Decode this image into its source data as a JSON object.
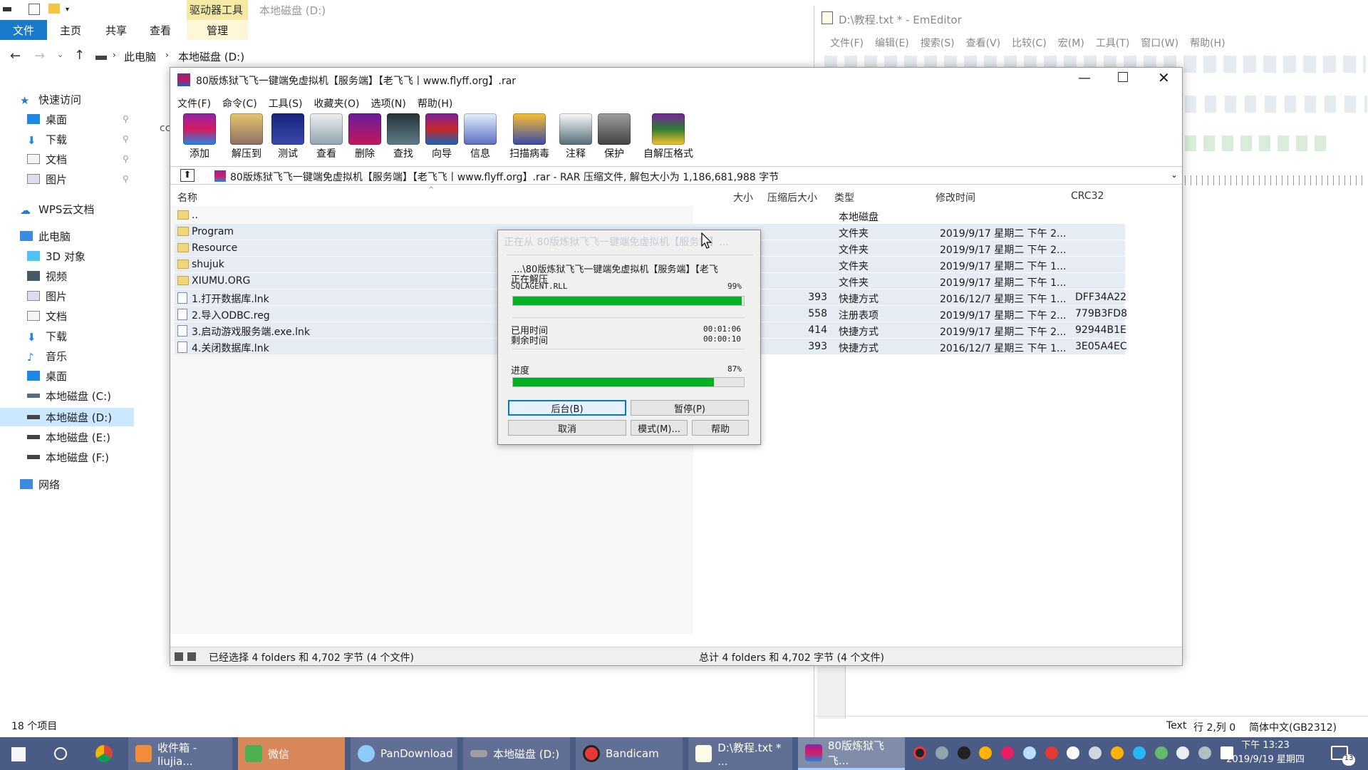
{
  "explorer": {
    "ribbon_context_tab": "驱动器工具",
    "title": "本地磁盘 (D:)",
    "tabs": [
      "文件",
      "主页",
      "共享",
      "查看",
      "管理"
    ],
    "breadcrumb": [
      "此电脑",
      "本地磁盘 (D:)"
    ],
    "nav": [
      "快速访问",
      "桌面",
      "下载",
      "文档",
      "图片",
      "WPS云文档",
      "此电脑",
      "3D 对象",
      "视频",
      "图片",
      "文档",
      "下载",
      "音乐",
      "桌面",
      "本地磁盘 (C:)",
      "本地磁盘 (D:)",
      "本地磁盘 (E:)",
      "本地磁盘 (F:)",
      "网络"
    ],
    "item_count": "18 个项目",
    "partial_text": "cc"
  },
  "emeditor": {
    "title": "D:\\教程.txt * - EmEditor",
    "menu": [
      "文件(F)",
      "编辑(E)",
      "搜索(S)",
      "查看(V)",
      "比较(C)",
      "宏(M)",
      "工具(T)",
      "窗口(W)",
      "帮助(H)"
    ],
    "status": [
      "Text",
      "行 2,列 0",
      "简体中文(GB2312)"
    ]
  },
  "winrar": {
    "title": "80版炼狱飞飞一键端免虚拟机【服务端】【老飞飞丨www.flyff.org】.rar",
    "menu": [
      "文件(F)",
      "命令(C)",
      "工具(S)",
      "收藏夹(O)",
      "选项(N)",
      "帮助(H)"
    ],
    "toolbar": [
      "添加",
      "解压到",
      "测试",
      "查看",
      "删除",
      "查找",
      "向导",
      "信息",
      "扫描病毒",
      "注释",
      "保护",
      "自解压格式"
    ],
    "path": "80版炼狱飞飞一键端免虚拟机【服务端】【老飞飞丨www.flyff.org】.rar - RAR 压缩文件, 解包大小为 1,186,681,988 字节",
    "columns": [
      "名称",
      "大小",
      "压缩后大小",
      "类型",
      "修改时间",
      "CRC32"
    ],
    "files": [
      {
        "name": "..",
        "size": "",
        "packed": "",
        "type": "本地磁盘",
        "modified": "",
        "crc": "",
        "kind": "up"
      },
      {
        "name": "Program",
        "size": "",
        "packed": "",
        "type": "文件夹",
        "modified": "2019/9/17 星期二 下午 2...",
        "crc": "",
        "kind": "folder"
      },
      {
        "name": "Resource",
        "size": "",
        "packed": "",
        "type": "文件夹",
        "modified": "2019/9/17 星期二 下午 2...",
        "crc": "",
        "kind": "folder"
      },
      {
        "name": "shujuk",
        "size": "",
        "packed": "",
        "type": "文件夹",
        "modified": "2019/9/17 星期二 下午 1...",
        "crc": "",
        "kind": "folder"
      },
      {
        "name": "XIUMU.ORG",
        "size": "",
        "packed": "",
        "type": "文件夹",
        "modified": "2019/9/17 星期二 下午 1...",
        "crc": "",
        "kind": "folder"
      },
      {
        "name": "1.打开数据库.lnk",
        "size": "",
        "packed": "393",
        "type": "快捷方式",
        "modified": "2016/12/7 星期三 下午 1...",
        "crc": "DFF34A22",
        "kind": "file"
      },
      {
        "name": "2.导入ODBC.reg",
        "size": "",
        "packed": "558",
        "type": "注册表项",
        "modified": "2019/9/17 星期二 下午 2...",
        "crc": "779B3FD8",
        "kind": "file"
      },
      {
        "name": "3.启动游戏服务端.exe.lnk",
        "size": "",
        "packed": "414",
        "type": "快捷方式",
        "modified": "2019/9/17 星期二 下午 2...",
        "crc": "92944B1E",
        "kind": "file"
      },
      {
        "name": "4.关闭数据库.lnk",
        "size": "",
        "packed": "393",
        "type": "快捷方式",
        "modified": "2016/12/7 星期三 下午 1...",
        "crc": "3E05A4EC",
        "kind": "file"
      }
    ],
    "status_left": "已经选择 4 folders 和 4,702 字节 (4 个文件)",
    "status_right": "总计 4 folders 和 4,702 字节 (4 个文件)"
  },
  "dialog": {
    "title": "正在从 80版炼狱飞飞一键端免虚拟机【服务端】...",
    "archive": "...\\80版炼狱飞飞一键端免虚拟机【服务端】【老飞",
    "action": "正在解压",
    "current_file": "SQLAGENT.RLL",
    "file_percent_label": "99%",
    "file_progress": 0.99,
    "elapsed_label": "已用时间",
    "elapsed": "00:01:06",
    "remaining_label": "剩余时间",
    "remaining": "00:00:10",
    "progress_label": "进度",
    "total_percent_label": "87%",
    "total_progress": 0.87,
    "buttons": {
      "background": "后台(B)",
      "pause": "暂停(P)",
      "cancel": "取消",
      "mode": "模式(M)...",
      "help": "帮助"
    }
  },
  "taskbar": {
    "items": [
      "收件箱 - liujia...",
      "微信",
      "PanDownload",
      "本地磁盘 (D:)",
      "Bandicam",
      "D:\\教程.txt * ...",
      "80版炼狱飞飞..."
    ],
    "time": "下午 13:23",
    "date": "2019/9/19 星期四",
    "notif_count": "13"
  },
  "colors": {
    "progress": "#06b025",
    "taskbar": "#4a5c85",
    "selection": "#cce8ff"
  }
}
